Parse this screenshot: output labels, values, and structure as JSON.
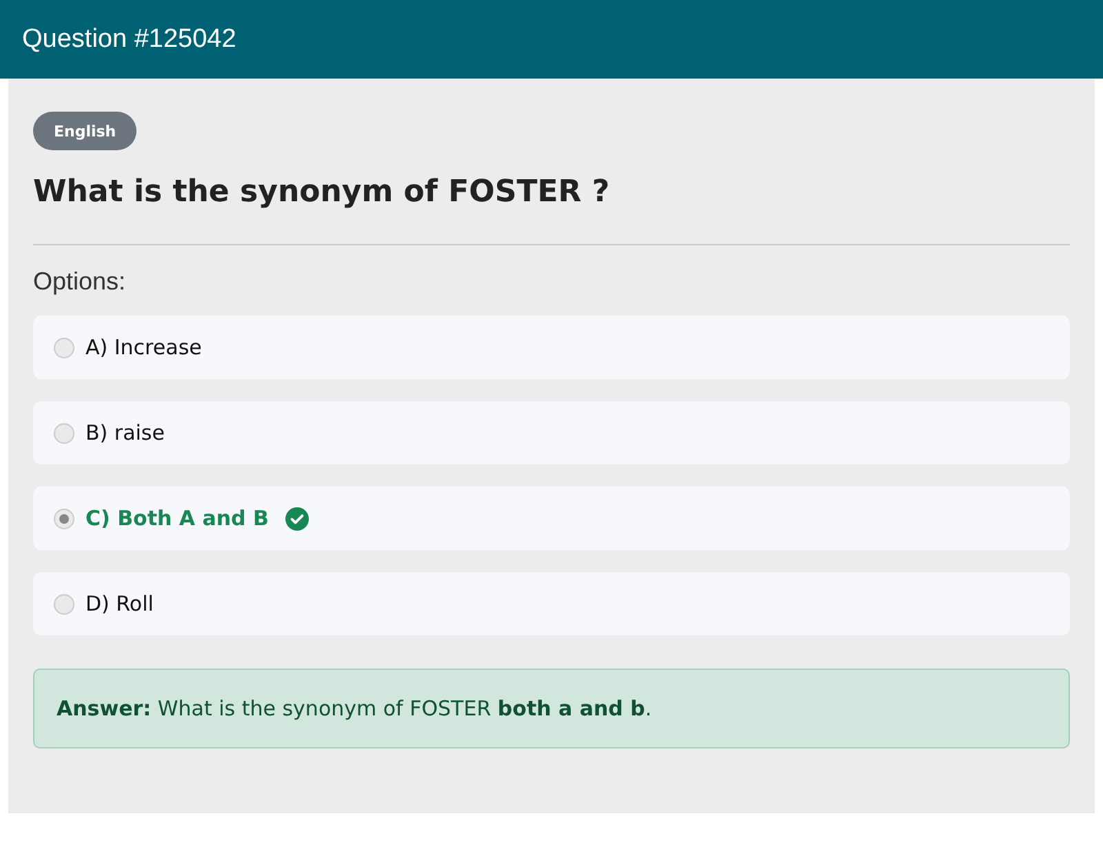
{
  "header": {
    "title": "Question #125042"
  },
  "badge": "English",
  "question": "What is the synonym of FOSTER ?",
  "options_label": "Options:",
  "options": [
    {
      "label": "A) Increase",
      "selected": false,
      "correct": false
    },
    {
      "label": "B) raise",
      "selected": false,
      "correct": false
    },
    {
      "label": "C) Both A and B",
      "selected": true,
      "correct": true
    },
    {
      "label": "D) Roll",
      "selected": false,
      "correct": false
    }
  ],
  "answer": "**Answer:** What is the synonym of FOSTER **both a and b**."
}
